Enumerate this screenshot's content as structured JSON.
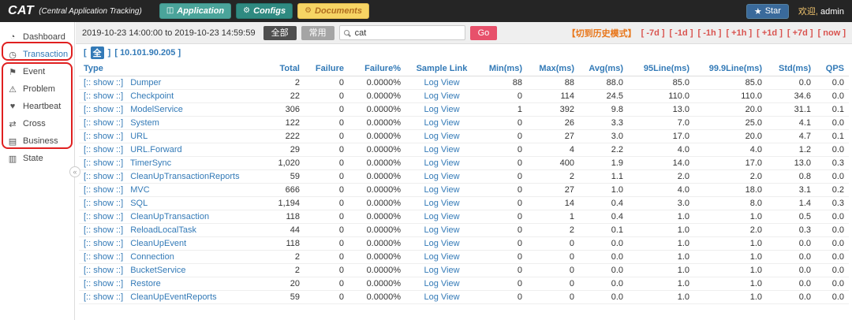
{
  "header": {
    "logo": "CAT",
    "subtitle": "(Central Application Tracking)",
    "nav": [
      {
        "label": "Application",
        "icon": "◫"
      },
      {
        "label": "Configs",
        "icon": "⚙"
      },
      {
        "label": "Documents",
        "icon": "⚙"
      }
    ],
    "star_icon": "★",
    "star_label": "Star",
    "welcome_prefix": "欢迎,",
    "username": "admin"
  },
  "sidebar": {
    "items": [
      {
        "label": "Dashboard",
        "icon": "◔"
      },
      {
        "label": "Transaction",
        "icon": "◷"
      },
      {
        "label": "Event",
        "icon": "⚑"
      },
      {
        "label": "Problem",
        "icon": "⚠"
      },
      {
        "label": "Heartbeat",
        "icon": "♥"
      },
      {
        "label": "Cross",
        "icon": "⇄"
      },
      {
        "label": "Business",
        "icon": "▤"
      },
      {
        "label": "State",
        "icon": "▥"
      }
    ],
    "collapse_glyph": "«"
  },
  "toolbar": {
    "date_range": "2019-10-23 14:00:00 to 2019-10-23 14:59:59",
    "all_button": "全部",
    "common_button": "常用",
    "search_value": "cat",
    "go_button": "Go",
    "history_mode_link": "【切到历史模式】",
    "time_links": [
      "[ -7d ]",
      "[ -1d ]",
      "[ -1h ]",
      "[ +1h ]",
      "[ +1d ]",
      "[ +7d ]",
      "[ now ]"
    ]
  },
  "machine_bar": {
    "bracket_open": "[",
    "bracket_close": "]",
    "all_label": "全",
    "ip_link": "[ 10.101.90.205 ]"
  },
  "table": {
    "headers": [
      "Type",
      "Total",
      "Failure",
      "Failure%",
      "Sample Link",
      "Min(ms)",
      "Max(ms)",
      "Avg(ms)",
      "95Line(ms)",
      "99.9Line(ms)",
      "Std(ms)",
      "QPS"
    ],
    "show_label": "[:: show ::]",
    "log_view_label": "Log View",
    "rows": [
      {
        "type": "Dumper",
        "total": "2",
        "failure": "0",
        "failure_pct": "0.0000%",
        "min": "88",
        "max": "88",
        "avg": "88.0",
        "p95": "85.0",
        "p999": "85.0",
        "std": "0.0",
        "qps": "0.0"
      },
      {
        "type": "Checkpoint",
        "total": "22",
        "failure": "0",
        "failure_pct": "0.0000%",
        "min": "0",
        "max": "114",
        "avg": "24.5",
        "p95": "110.0",
        "p999": "110.0",
        "std": "34.6",
        "qps": "0.0"
      },
      {
        "type": "ModelService",
        "total": "306",
        "failure": "0",
        "failure_pct": "0.0000%",
        "min": "1",
        "max": "392",
        "avg": "9.8",
        "p95": "13.0",
        "p999": "20.0",
        "std": "31.1",
        "qps": "0.1"
      },
      {
        "type": "System",
        "total": "122",
        "failure": "0",
        "failure_pct": "0.0000%",
        "min": "0",
        "max": "26",
        "avg": "3.3",
        "p95": "7.0",
        "p999": "25.0",
        "std": "4.1",
        "qps": "0.0"
      },
      {
        "type": "URL",
        "total": "222",
        "failure": "0",
        "failure_pct": "0.0000%",
        "min": "0",
        "max": "27",
        "avg": "3.0",
        "p95": "17.0",
        "p999": "20.0",
        "std": "4.7",
        "qps": "0.1"
      },
      {
        "type": "URL.Forward",
        "total": "29",
        "failure": "0",
        "failure_pct": "0.0000%",
        "min": "0",
        "max": "4",
        "avg": "2.2",
        "p95": "4.0",
        "p999": "4.0",
        "std": "1.2",
        "qps": "0.0"
      },
      {
        "type": "TimerSync",
        "total": "1,020",
        "failure": "0",
        "failure_pct": "0.0000%",
        "min": "0",
        "max": "400",
        "avg": "1.9",
        "p95": "14.0",
        "p999": "17.0",
        "std": "13.0",
        "qps": "0.3"
      },
      {
        "type": "CleanUpTransactionReports",
        "total": "59",
        "failure": "0",
        "failure_pct": "0.0000%",
        "min": "0",
        "max": "2",
        "avg": "1.1",
        "p95": "2.0",
        "p999": "2.0",
        "std": "0.8",
        "qps": "0.0"
      },
      {
        "type": "MVC",
        "total": "666",
        "failure": "0",
        "failure_pct": "0.0000%",
        "min": "0",
        "max": "27",
        "avg": "1.0",
        "p95": "4.0",
        "p999": "18.0",
        "std": "3.1",
        "qps": "0.2"
      },
      {
        "type": "SQL",
        "total": "1,194",
        "failure": "0",
        "failure_pct": "0.0000%",
        "min": "0",
        "max": "14",
        "avg": "0.4",
        "p95": "3.0",
        "p999": "8.0",
        "std": "1.4",
        "qps": "0.3"
      },
      {
        "type": "CleanUpTransaction",
        "total": "118",
        "failure": "0",
        "failure_pct": "0.0000%",
        "min": "0",
        "max": "1",
        "avg": "0.4",
        "p95": "1.0",
        "p999": "1.0",
        "std": "0.5",
        "qps": "0.0"
      },
      {
        "type": "ReloadLocalTask",
        "total": "44",
        "failure": "0",
        "failure_pct": "0.0000%",
        "min": "0",
        "max": "2",
        "avg": "0.1",
        "p95": "1.0",
        "p999": "2.0",
        "std": "0.3",
        "qps": "0.0"
      },
      {
        "type": "CleanUpEvent",
        "total": "118",
        "failure": "0",
        "failure_pct": "0.0000%",
        "min": "0",
        "max": "0",
        "avg": "0.0",
        "p95": "1.0",
        "p999": "1.0",
        "std": "0.0",
        "qps": "0.0"
      },
      {
        "type": "Connection",
        "total": "2",
        "failure": "0",
        "failure_pct": "0.0000%",
        "min": "0",
        "max": "0",
        "avg": "0.0",
        "p95": "1.0",
        "p999": "1.0",
        "std": "0.0",
        "qps": "0.0"
      },
      {
        "type": "BucketService",
        "total": "2",
        "failure": "0",
        "failure_pct": "0.0000%",
        "min": "0",
        "max": "0",
        "avg": "0.0",
        "p95": "1.0",
        "p999": "1.0",
        "std": "0.0",
        "qps": "0.0"
      },
      {
        "type": "Restore",
        "total": "20",
        "failure": "0",
        "failure_pct": "0.0000%",
        "min": "0",
        "max": "0",
        "avg": "0.0",
        "p95": "1.0",
        "p999": "1.0",
        "std": "0.0",
        "qps": "0.0"
      },
      {
        "type": "CleanUpEventReports",
        "total": "59",
        "failure": "0",
        "failure_pct": "0.0000%",
        "min": "0",
        "max": "0",
        "avg": "0.0",
        "p95": "1.0",
        "p999": "1.0",
        "std": "0.0",
        "qps": "0.0"
      }
    ]
  },
  "colors": {
    "topbar_bg": "#252525",
    "accent_teal": "#4aa49a",
    "accent_teal_dark": "#2f8a81",
    "accent_yellow": "#f7d564",
    "link_blue": "#337ab7",
    "go_red": "#e7516b",
    "history_orange": "#e87518",
    "time_link_red": "#d9534f",
    "annotation_red": "#e02020"
  }
}
